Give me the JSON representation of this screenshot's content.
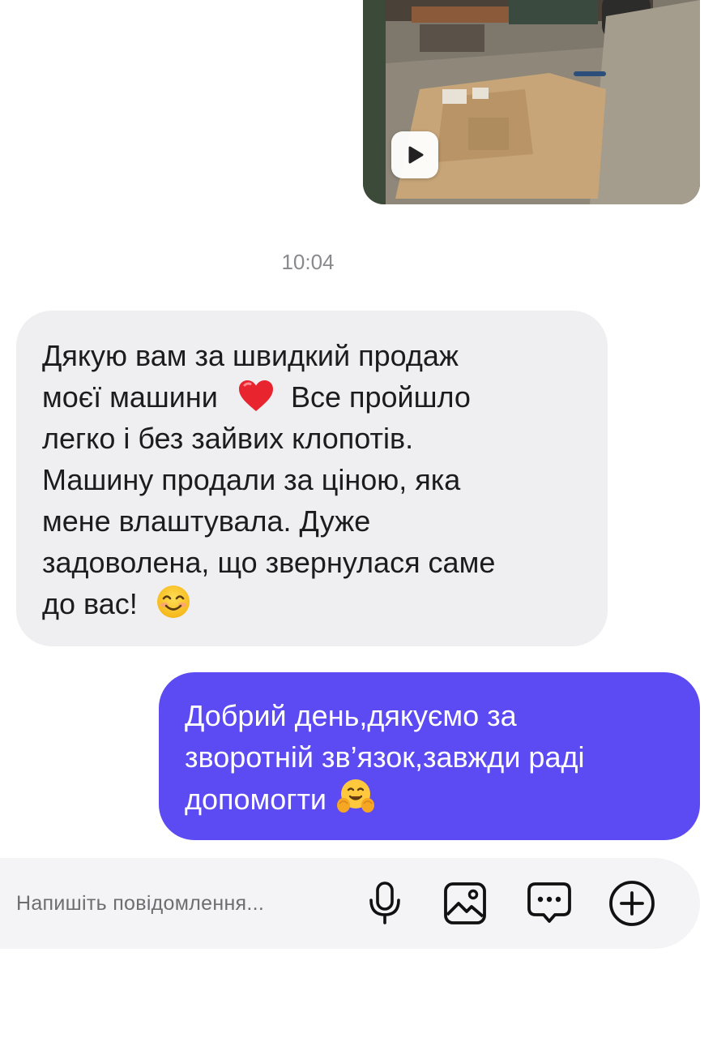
{
  "conversation": {
    "media_message": {
      "type": "video",
      "play_icon": "play-icon"
    },
    "timestamp": "10:04",
    "incoming_message": {
      "lines": [
        "Дякую вам за швидкий продаж",
        "моєї машини",
        "Все пройшло",
        "легко і без зайвих клопотів.",
        "Машину продали за ціною, яка",
        "мене влаштувала. Дуже",
        "задоволена, що звернулася саме",
        "до вас!"
      ],
      "emojis": [
        "red-heart",
        "smiling-face"
      ]
    },
    "outgoing_message": {
      "lines": [
        "Добрий день,дякуємо за",
        "зворотній зв’язок,завжди раді",
        "допомогти"
      ],
      "emojis": [
        "hugging-face"
      ],
      "bubble_color": "#5c4af2"
    }
  },
  "composer": {
    "placeholder": "Напишіть повідомлення...",
    "value": "",
    "icons": [
      "microphone-icon",
      "image-icon",
      "chat-bubble-icon",
      "plus-circle-icon"
    ]
  },
  "colors": {
    "incoming_bubble": "#efeff2",
    "outgoing_bubble": "#5c4af2",
    "timestamp": "#8a8a8e",
    "composer_bg": "#f4f4f6"
  }
}
